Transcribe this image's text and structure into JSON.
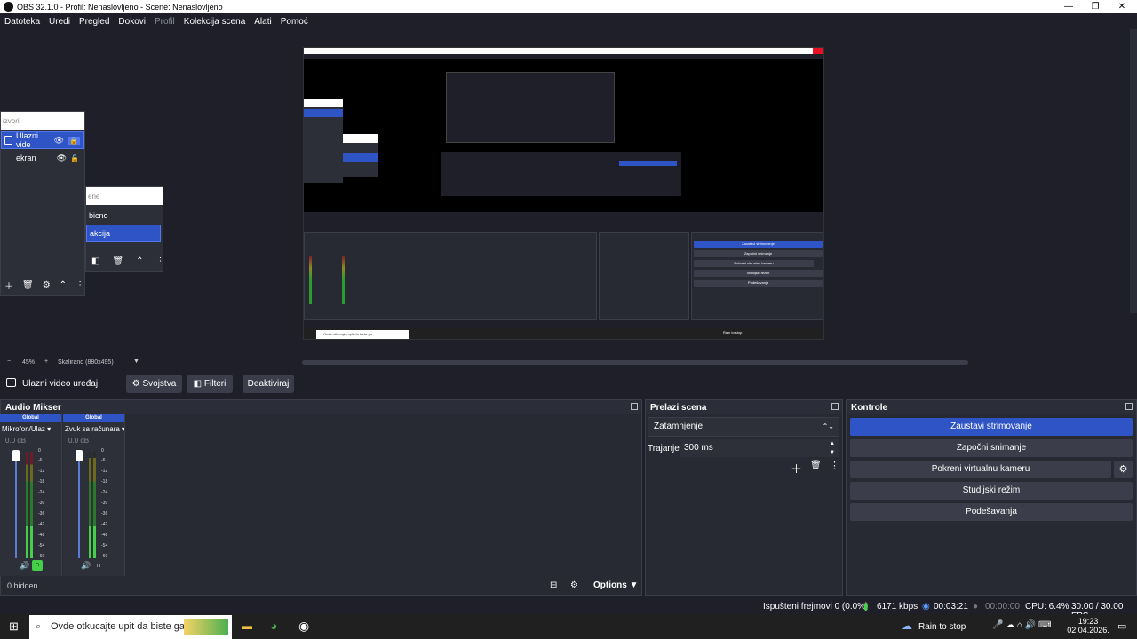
{
  "window": {
    "title": "OBS 32.1.0 - Profil: Nenaslovljeno - Scene: Nenaslovljeno",
    "min": "—",
    "max": "❐",
    "close": "✕"
  },
  "menu": [
    "Datoteka",
    "Uredi",
    "Pregled",
    "Dokovi",
    "Profil",
    "Kolekcija scena",
    "Alati",
    "Pomoć"
  ],
  "sources_popup": {
    "header": "izvori",
    "items": [
      "Ulazni vide",
      "ekran"
    ]
  },
  "scenes_popup": {
    "header": "ene",
    "items": [
      "bicno",
      "akcija"
    ]
  },
  "zoom": {
    "minus": "−",
    "value": "45%",
    "plus": "+",
    "scale": "Skalirano (880x495)"
  },
  "source_toolbar": {
    "source": "Ulazni video uređaj",
    "properties": "Svojstva",
    "filters": "Filteri",
    "deactivate": "Deaktiviraj"
  },
  "audio": {
    "title": "Audio Mikser",
    "channels": [
      {
        "global": "Global",
        "name": "Mikrofon/Ulaz",
        "db": "0.0 dB",
        "level": 0.3
      },
      {
        "global": "Global",
        "name": "Zvuk sa računara",
        "db": "0.0 dB",
        "level": 0.3
      }
    ],
    "scale": [
      "0",
      "-6",
      "-12",
      "-18",
      "-24",
      "-30",
      "-36",
      "-42",
      "-48",
      "-54",
      "-60"
    ],
    "hidden": "0 hidden",
    "options": "Options"
  },
  "transitions": {
    "title": "Prelazi scena",
    "transition": "Zatamnjenje",
    "duration_label": "Trajanje",
    "duration": "300 ms"
  },
  "controls": {
    "title": "Kontrole",
    "stop_stream": "Zaustavi strimovanje",
    "start_record": "Započni snimanje",
    "virtual_cam": "Pokreni virtualnu kameru",
    "studio": "Studijski režim",
    "settings": "Podešavanja"
  },
  "status": {
    "dropped": "Ispušteni frejmovi 0 (0.0%)",
    "bitrate": "6171 kbps",
    "stream_time": "00:03:21",
    "rec_time": "00:00:00",
    "cpu": "CPU: 6.4%",
    "fps": "30.00 / 30.00 FPS"
  },
  "taskbar": {
    "search": "Ovde otkucajte upit da biste ga",
    "weather": "Rain to stop",
    "time": "19:23",
    "date": "02.04.2026."
  },
  "nested": {
    "stop": "Zaustavi strimovanje",
    "rec": "Započni snimanje",
    "vcam": "Pokreni virtualnu kameru",
    "studio": "Studijski režim",
    "settings": "Podešavanja",
    "search": "Ovde otkucajte upit da biste ga",
    "weather": "Rain to stop"
  },
  "colors": {
    "accent": "#2f54c5",
    "bg": "#1e1f29",
    "panel": "#272a33",
    "button": "#3b3e4a"
  }
}
